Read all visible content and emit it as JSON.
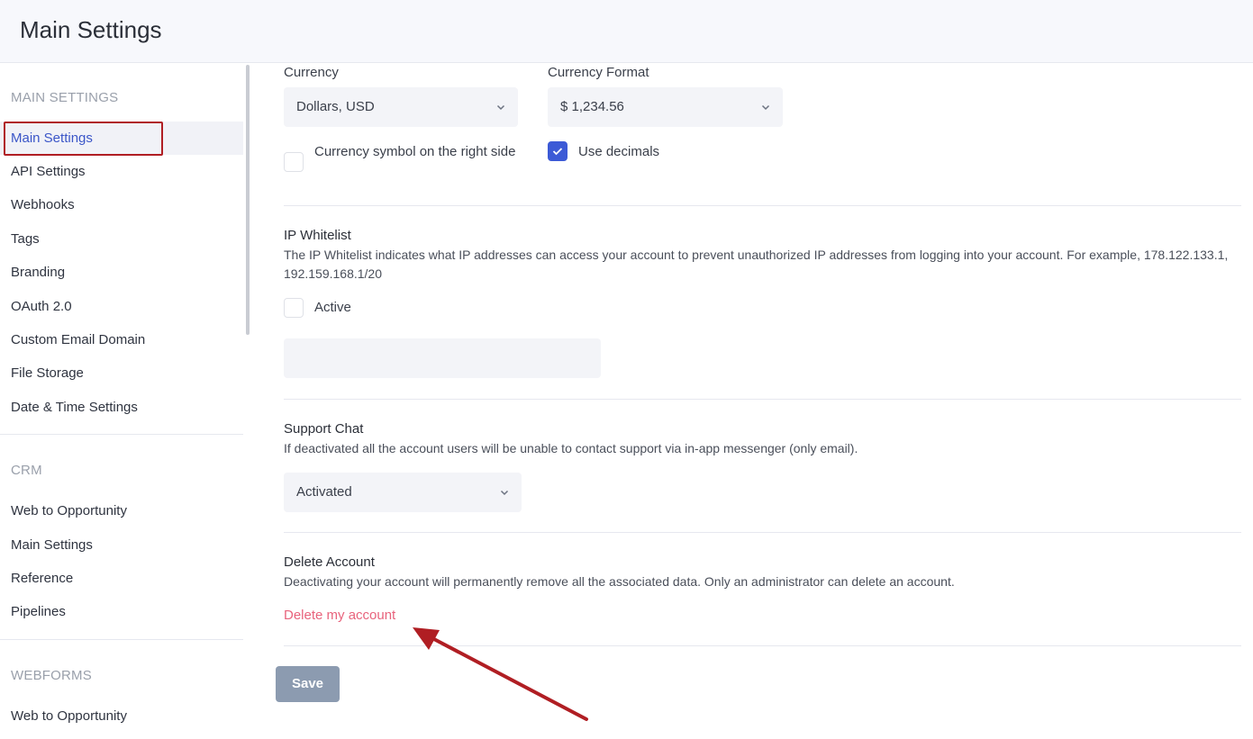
{
  "header": {
    "title": "Main Settings"
  },
  "sidebar": {
    "sections": [
      {
        "title": "MAIN SETTINGS",
        "items": [
          "Main Settings",
          "API Settings",
          "Webhooks",
          "Tags",
          "Branding",
          "OAuth 2.0",
          "Custom Email Domain",
          "File Storage",
          "Date & Time Settings"
        ]
      },
      {
        "title": "CRM",
        "items": [
          "Web to Opportunity",
          "Main Settings",
          "Reference",
          "Pipelines"
        ]
      },
      {
        "title": "WEBFORMS",
        "items": [
          "Web to Opportunity"
        ]
      }
    ],
    "active_item": "Main Settings"
  },
  "currency": {
    "label": "Currency",
    "value": "Dollars, USD",
    "format_label": "Currency Format",
    "format_value": "$ 1,234.56",
    "symbol_right_label": "Currency symbol on the right side",
    "symbol_right_checked": false,
    "use_decimals_label": "Use decimals",
    "use_decimals_checked": true
  },
  "ip_whitelist": {
    "title": "IP Whitelist",
    "description": "The IP Whitelist indicates what IP addresses can access your account to prevent unauthorized IP addresses from logging into your account. For example, 178.122.133.1, 192.159.168.1/20",
    "active_label": "Active",
    "active_checked": false,
    "input_value": ""
  },
  "support_chat": {
    "title": "Support Chat",
    "description": "If deactivated all the account users will be unable to contact support via in-app messenger (only email).",
    "value": "Activated"
  },
  "delete_account": {
    "title": "Delete Account",
    "description": "Deactivating your account will permanently remove all the associated data. Only an administrator can delete an account.",
    "link": "Delete my account"
  },
  "actions": {
    "save": "Save"
  },
  "colors": {
    "accent": "#3c5ad6",
    "danger": "#e8637c",
    "annotation": "#b01e23",
    "save_button": "#8c9bb0"
  }
}
